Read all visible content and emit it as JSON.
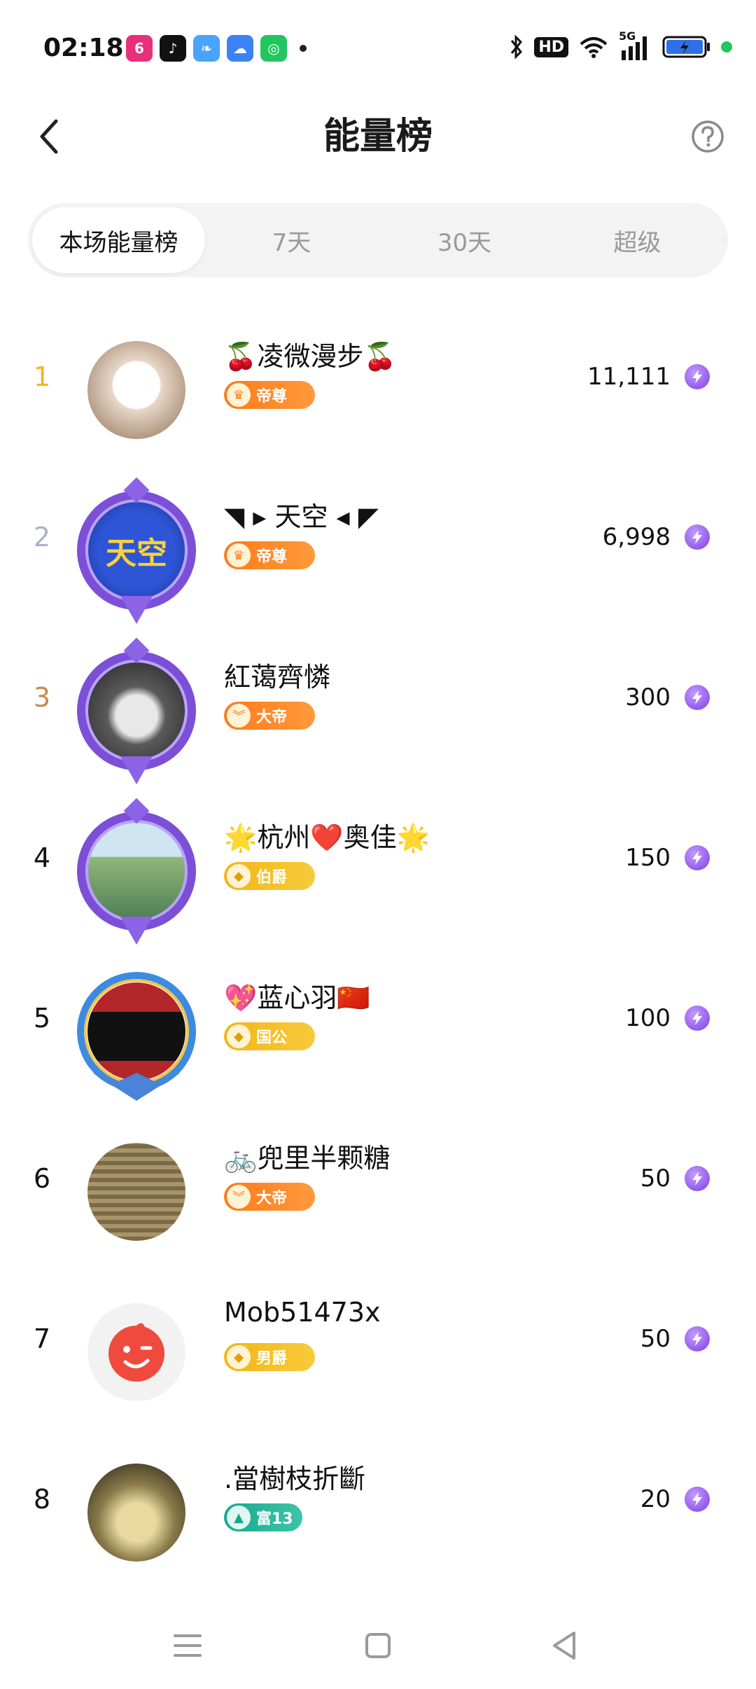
{
  "status_bar": {
    "time": "02:18",
    "apps": [
      {
        "icon": "app-6-icon",
        "label": "6",
        "color": "#e8307a"
      },
      {
        "icon": "douyin-icon",
        "label": "♪",
        "color": "#111111"
      },
      {
        "icon": "feather-app-icon",
        "label": "❧",
        "color": "#4aa3ff"
      },
      {
        "icon": "weather-icon",
        "label": "☁",
        "color": "#3b82f6"
      },
      {
        "icon": "camera-app-icon",
        "label": "◎",
        "color": "#22c55e"
      }
    ],
    "hd_label": "HD",
    "network_label": "5G"
  },
  "header": {
    "title": "能量榜"
  },
  "tabs": [
    {
      "label": "本场能量榜",
      "active": true
    },
    {
      "label": "7天",
      "active": false
    },
    {
      "label": "30天",
      "active": false
    },
    {
      "label": "超级",
      "active": false
    }
  ],
  "ranking": [
    {
      "rank": "1",
      "name": "🍒凌微漫步🍒",
      "badge": "帝尊",
      "badge_style": "orange",
      "value": "11,111",
      "avatar_colors": [
        "#e8d7c7",
        "#ffffff"
      ],
      "frame": "none"
    },
    {
      "rank": "2",
      "name": "◥ ▸ 天空 ◂ ◤",
      "badge": "帝尊",
      "badge_style": "orange",
      "value": "6,998",
      "avatar_colors": [
        "#1d3fb0",
        "#f7d23a"
      ],
      "frame": "purple"
    },
    {
      "rank": "3",
      "name": "紅蔼齊憐",
      "badge": "大帝",
      "badge_style": "orange",
      "value": "300",
      "avatar_colors": [
        "#3a3a3a",
        "#d9d9d9"
      ],
      "frame": "purple"
    },
    {
      "rank": "4",
      "name": "🌟杭州❤️奥佳🌟",
      "badge": "伯爵",
      "badge_style": "yellow",
      "value": "150",
      "avatar_colors": [
        "#6fae8a",
        "#cfe6f0"
      ],
      "frame": "purple"
    },
    {
      "rank": "5",
      "name": "💖蓝心羽🇨🇳",
      "badge": "国公",
      "badge_style": "yellow",
      "value": "100",
      "avatar_colors": [
        "#b3262a",
        "#222222"
      ],
      "frame": "blue"
    },
    {
      "rank": "6",
      "name": "🚲兜里半颗糖",
      "badge": "大帝",
      "badge_style": "orange",
      "value": "50",
      "avatar_colors": [
        "#6b5a3a",
        "#a89468"
      ],
      "frame": "none"
    },
    {
      "rank": "7",
      "name": "Mob51473x",
      "badge": "男爵",
      "badge_style": "yellow",
      "value": "50",
      "avatar_colors": [
        "#f04a3e",
        "#f2f2f2"
      ],
      "frame": "none"
    },
    {
      "rank": "8",
      "name": ".當樹枝折斷",
      "badge": "富13",
      "badge_style": "teal",
      "value": "20",
      "avatar_colors": [
        "#2d2a1f",
        "#e9d9a0"
      ],
      "frame": "none"
    }
  ]
}
